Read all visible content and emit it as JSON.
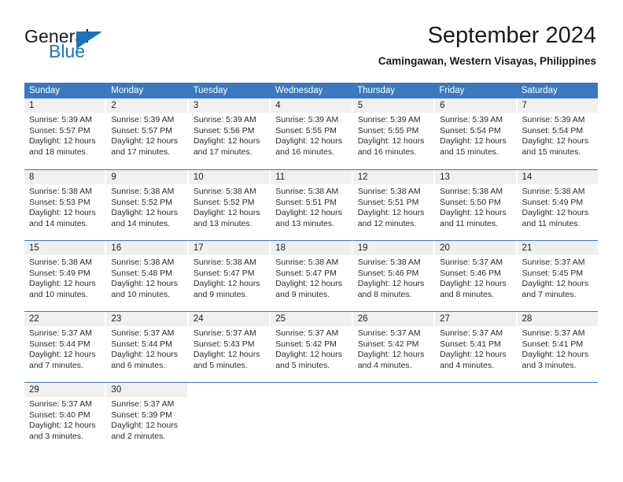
{
  "brand": {
    "name_top": "General",
    "name_bottom": "Blue",
    "flag_icon": "triangle-flag-icon",
    "color_primary": "#1a72bb"
  },
  "header": {
    "month_title": "September 2024",
    "location": "Camingawan, Western Visayas, Philippines"
  },
  "calendar": {
    "accent_color": "#3a79bd",
    "day_band_color": "#f0f0f0",
    "weekdays": [
      "Sunday",
      "Monday",
      "Tuesday",
      "Wednesday",
      "Thursday",
      "Friday",
      "Saturday"
    ],
    "weeks": [
      [
        {
          "day": "1",
          "sunrise": "Sunrise: 5:39 AM",
          "sunset": "Sunset: 5:57 PM",
          "daylight_1": "Daylight: 12 hours",
          "daylight_2": "and 18 minutes."
        },
        {
          "day": "2",
          "sunrise": "Sunrise: 5:39 AM",
          "sunset": "Sunset: 5:57 PM",
          "daylight_1": "Daylight: 12 hours",
          "daylight_2": "and 17 minutes."
        },
        {
          "day": "3",
          "sunrise": "Sunrise: 5:39 AM",
          "sunset": "Sunset: 5:56 PM",
          "daylight_1": "Daylight: 12 hours",
          "daylight_2": "and 17 minutes."
        },
        {
          "day": "4",
          "sunrise": "Sunrise: 5:39 AM",
          "sunset": "Sunset: 5:55 PM",
          "daylight_1": "Daylight: 12 hours",
          "daylight_2": "and 16 minutes."
        },
        {
          "day": "5",
          "sunrise": "Sunrise: 5:39 AM",
          "sunset": "Sunset: 5:55 PM",
          "daylight_1": "Daylight: 12 hours",
          "daylight_2": "and 16 minutes."
        },
        {
          "day": "6",
          "sunrise": "Sunrise: 5:39 AM",
          "sunset": "Sunset: 5:54 PM",
          "daylight_1": "Daylight: 12 hours",
          "daylight_2": "and 15 minutes."
        },
        {
          "day": "7",
          "sunrise": "Sunrise: 5:39 AM",
          "sunset": "Sunset: 5:54 PM",
          "daylight_1": "Daylight: 12 hours",
          "daylight_2": "and 15 minutes."
        }
      ],
      [
        {
          "day": "8",
          "sunrise": "Sunrise: 5:38 AM",
          "sunset": "Sunset: 5:53 PM",
          "daylight_1": "Daylight: 12 hours",
          "daylight_2": "and 14 minutes."
        },
        {
          "day": "9",
          "sunrise": "Sunrise: 5:38 AM",
          "sunset": "Sunset: 5:52 PM",
          "daylight_1": "Daylight: 12 hours",
          "daylight_2": "and 14 minutes."
        },
        {
          "day": "10",
          "sunrise": "Sunrise: 5:38 AM",
          "sunset": "Sunset: 5:52 PM",
          "daylight_1": "Daylight: 12 hours",
          "daylight_2": "and 13 minutes."
        },
        {
          "day": "11",
          "sunrise": "Sunrise: 5:38 AM",
          "sunset": "Sunset: 5:51 PM",
          "daylight_1": "Daylight: 12 hours",
          "daylight_2": "and 13 minutes."
        },
        {
          "day": "12",
          "sunrise": "Sunrise: 5:38 AM",
          "sunset": "Sunset: 5:51 PM",
          "daylight_1": "Daylight: 12 hours",
          "daylight_2": "and 12 minutes."
        },
        {
          "day": "13",
          "sunrise": "Sunrise: 5:38 AM",
          "sunset": "Sunset: 5:50 PM",
          "daylight_1": "Daylight: 12 hours",
          "daylight_2": "and 11 minutes."
        },
        {
          "day": "14",
          "sunrise": "Sunrise: 5:38 AM",
          "sunset": "Sunset: 5:49 PM",
          "daylight_1": "Daylight: 12 hours",
          "daylight_2": "and 11 minutes."
        }
      ],
      [
        {
          "day": "15",
          "sunrise": "Sunrise: 5:38 AM",
          "sunset": "Sunset: 5:49 PM",
          "daylight_1": "Daylight: 12 hours",
          "daylight_2": "and 10 minutes."
        },
        {
          "day": "16",
          "sunrise": "Sunrise: 5:38 AM",
          "sunset": "Sunset: 5:48 PM",
          "daylight_1": "Daylight: 12 hours",
          "daylight_2": "and 10 minutes."
        },
        {
          "day": "17",
          "sunrise": "Sunrise: 5:38 AM",
          "sunset": "Sunset: 5:47 PM",
          "daylight_1": "Daylight: 12 hours",
          "daylight_2": "and 9 minutes."
        },
        {
          "day": "18",
          "sunrise": "Sunrise: 5:38 AM",
          "sunset": "Sunset: 5:47 PM",
          "daylight_1": "Daylight: 12 hours",
          "daylight_2": "and 9 minutes."
        },
        {
          "day": "19",
          "sunrise": "Sunrise: 5:38 AM",
          "sunset": "Sunset: 5:46 PM",
          "daylight_1": "Daylight: 12 hours",
          "daylight_2": "and 8 minutes."
        },
        {
          "day": "20",
          "sunrise": "Sunrise: 5:37 AM",
          "sunset": "Sunset: 5:46 PM",
          "daylight_1": "Daylight: 12 hours",
          "daylight_2": "and 8 minutes."
        },
        {
          "day": "21",
          "sunrise": "Sunrise: 5:37 AM",
          "sunset": "Sunset: 5:45 PM",
          "daylight_1": "Daylight: 12 hours",
          "daylight_2": "and 7 minutes."
        }
      ],
      [
        {
          "day": "22",
          "sunrise": "Sunrise: 5:37 AM",
          "sunset": "Sunset: 5:44 PM",
          "daylight_1": "Daylight: 12 hours",
          "daylight_2": "and 7 minutes."
        },
        {
          "day": "23",
          "sunrise": "Sunrise: 5:37 AM",
          "sunset": "Sunset: 5:44 PM",
          "daylight_1": "Daylight: 12 hours",
          "daylight_2": "and 6 minutes."
        },
        {
          "day": "24",
          "sunrise": "Sunrise: 5:37 AM",
          "sunset": "Sunset: 5:43 PM",
          "daylight_1": "Daylight: 12 hours",
          "daylight_2": "and 5 minutes."
        },
        {
          "day": "25",
          "sunrise": "Sunrise: 5:37 AM",
          "sunset": "Sunset: 5:42 PM",
          "daylight_1": "Daylight: 12 hours",
          "daylight_2": "and 5 minutes."
        },
        {
          "day": "26",
          "sunrise": "Sunrise: 5:37 AM",
          "sunset": "Sunset: 5:42 PM",
          "daylight_1": "Daylight: 12 hours",
          "daylight_2": "and 4 minutes."
        },
        {
          "day": "27",
          "sunrise": "Sunrise: 5:37 AM",
          "sunset": "Sunset: 5:41 PM",
          "daylight_1": "Daylight: 12 hours",
          "daylight_2": "and 4 minutes."
        },
        {
          "day": "28",
          "sunrise": "Sunrise: 5:37 AM",
          "sunset": "Sunset: 5:41 PM",
          "daylight_1": "Daylight: 12 hours",
          "daylight_2": "and 3 minutes."
        }
      ],
      [
        {
          "day": "29",
          "sunrise": "Sunrise: 5:37 AM",
          "sunset": "Sunset: 5:40 PM",
          "daylight_1": "Daylight: 12 hours",
          "daylight_2": "and 3 minutes."
        },
        {
          "day": "30",
          "sunrise": "Sunrise: 5:37 AM",
          "sunset": "Sunset: 5:39 PM",
          "daylight_1": "Daylight: 12 hours",
          "daylight_2": "and 2 minutes."
        },
        {
          "day": "",
          "sunrise": "",
          "sunset": "",
          "daylight_1": "",
          "daylight_2": ""
        },
        {
          "day": "",
          "sunrise": "",
          "sunset": "",
          "daylight_1": "",
          "daylight_2": ""
        },
        {
          "day": "",
          "sunrise": "",
          "sunset": "",
          "daylight_1": "",
          "daylight_2": ""
        },
        {
          "day": "",
          "sunrise": "",
          "sunset": "",
          "daylight_1": "",
          "daylight_2": ""
        },
        {
          "day": "",
          "sunrise": "",
          "sunset": "",
          "daylight_1": "",
          "daylight_2": ""
        }
      ]
    ]
  }
}
